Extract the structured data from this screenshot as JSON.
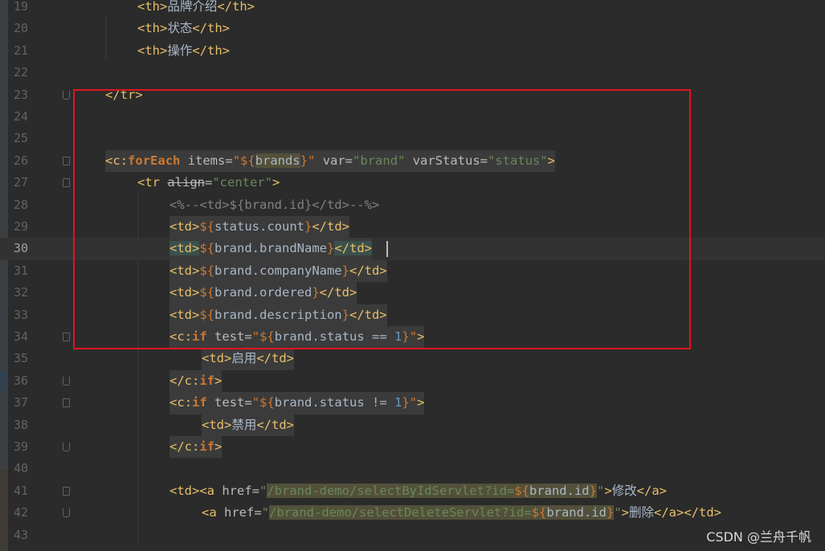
{
  "lines": [
    {
      "n": "19",
      "code": {
        "a": "<th>",
        "b": "品牌介绍",
        "c": "</th>"
      }
    },
    {
      "n": "20",
      "code": {
        "a": "<th>",
        "b": "状态",
        "c": "</th>"
      }
    },
    {
      "n": "21",
      "code": {
        "a": "<th>",
        "b": "操作",
        "c": "</th>"
      }
    },
    {
      "n": "22"
    },
    {
      "n": "23",
      "code": {
        "a": "</tr>"
      }
    },
    {
      "n": "24"
    },
    {
      "n": "25"
    },
    {
      "n": "26",
      "code": {
        "lt": "<",
        "c": "c",
        "colon": ":",
        "fe": "forEach",
        "items": " items=",
        "q1": "\"${",
        "brands": "brands",
        "q2": "}\"",
        "var": " var=",
        "brand": "\"brand\"",
        "vs": " varStatus=",
        "status": "\"status\"",
        "gt": ">"
      }
    },
    {
      "n": "27",
      "code": {
        "tr": "<tr ",
        "align": "align",
        "eq": "=",
        "center": "\"center\"",
        "gt": ">"
      }
    },
    {
      "n": "28",
      "code": {
        "c": "<%--<td>${brand.id}</td>--%>"
      }
    },
    {
      "n": "29",
      "code": {
        "o": "<td>",
        "e1": "${",
        "e2": "status.count",
        "e3": "}",
        "cl": "</td>"
      }
    },
    {
      "n": "30",
      "code": {
        "o": "<td>",
        "e1": "${",
        "e2": "brand.brandName",
        "e3": "}",
        "cl": "</td>"
      }
    },
    {
      "n": "31",
      "code": {
        "o": "<td>",
        "e1": "${",
        "e2": "brand.companyName",
        "e3": "}",
        "cl": "</td>"
      }
    },
    {
      "n": "32",
      "code": {
        "o": "<td>",
        "e1": "${",
        "e2": "brand.ordered",
        "e3": "}",
        "cl": "</td>"
      }
    },
    {
      "n": "33",
      "code": {
        "o": "<td>",
        "e1": "${",
        "e2": "brand.description",
        "e3": "}",
        "cl": "</td>"
      }
    },
    {
      "n": "34",
      "code": {
        "lt": "<",
        "c": "c",
        "colon": ":",
        "kw": "if",
        "test": " test=",
        "q1": "\"${",
        "expr": "brand.status == ",
        "num": "1",
        "q2": "}\"",
        "gt": ">"
      }
    },
    {
      "n": "35",
      "code": {
        "a": "<td>",
        "b": "启用",
        "c": "</td>"
      }
    },
    {
      "n": "36",
      "code": {
        "lt": "</",
        "c": "c",
        "colon": ":",
        "kw": "if",
        "gt": ">"
      }
    },
    {
      "n": "37",
      "code": {
        "lt": "<",
        "c": "c",
        "colon": ":",
        "kw": "if",
        "test": " test=",
        "q1": "\"${",
        "expr": "brand.status != ",
        "num": "1",
        "q2": "}\"",
        "gt": ">"
      }
    },
    {
      "n": "38",
      "code": {
        "a": "<td>",
        "b": "禁用",
        "c": "</td>"
      }
    },
    {
      "n": "39",
      "code": {
        "lt": "</",
        "c": "c",
        "colon": ":",
        "kw": "if",
        "gt": ">"
      }
    },
    {
      "n": "40"
    },
    {
      "n": "41",
      "code": {
        "td": "<td>",
        "a": "<a ",
        "href": "href=",
        "q": "\"",
        "url": "/brand-demo/selectByIdServlet?id=",
        "e1": "${",
        "e2": "brand.id",
        "e3": "}",
        "q2": "\"",
        "gt": ">",
        "txt": "修改",
        "ca": "</a>"
      }
    },
    {
      "n": "42",
      "code": {
        "a": "<a ",
        "href": "href=",
        "q": "\"",
        "url": "/brand-demo/selectDeleteServlet?id=",
        "e1": "${",
        "e2": "brand.id",
        "e3": "}",
        "q2": "\"",
        "gt": ">",
        "txt": "删除",
        "ca": "</a></td>"
      }
    },
    {
      "n": "43"
    }
  ],
  "watermark": "CSDN @兰舟千帆"
}
